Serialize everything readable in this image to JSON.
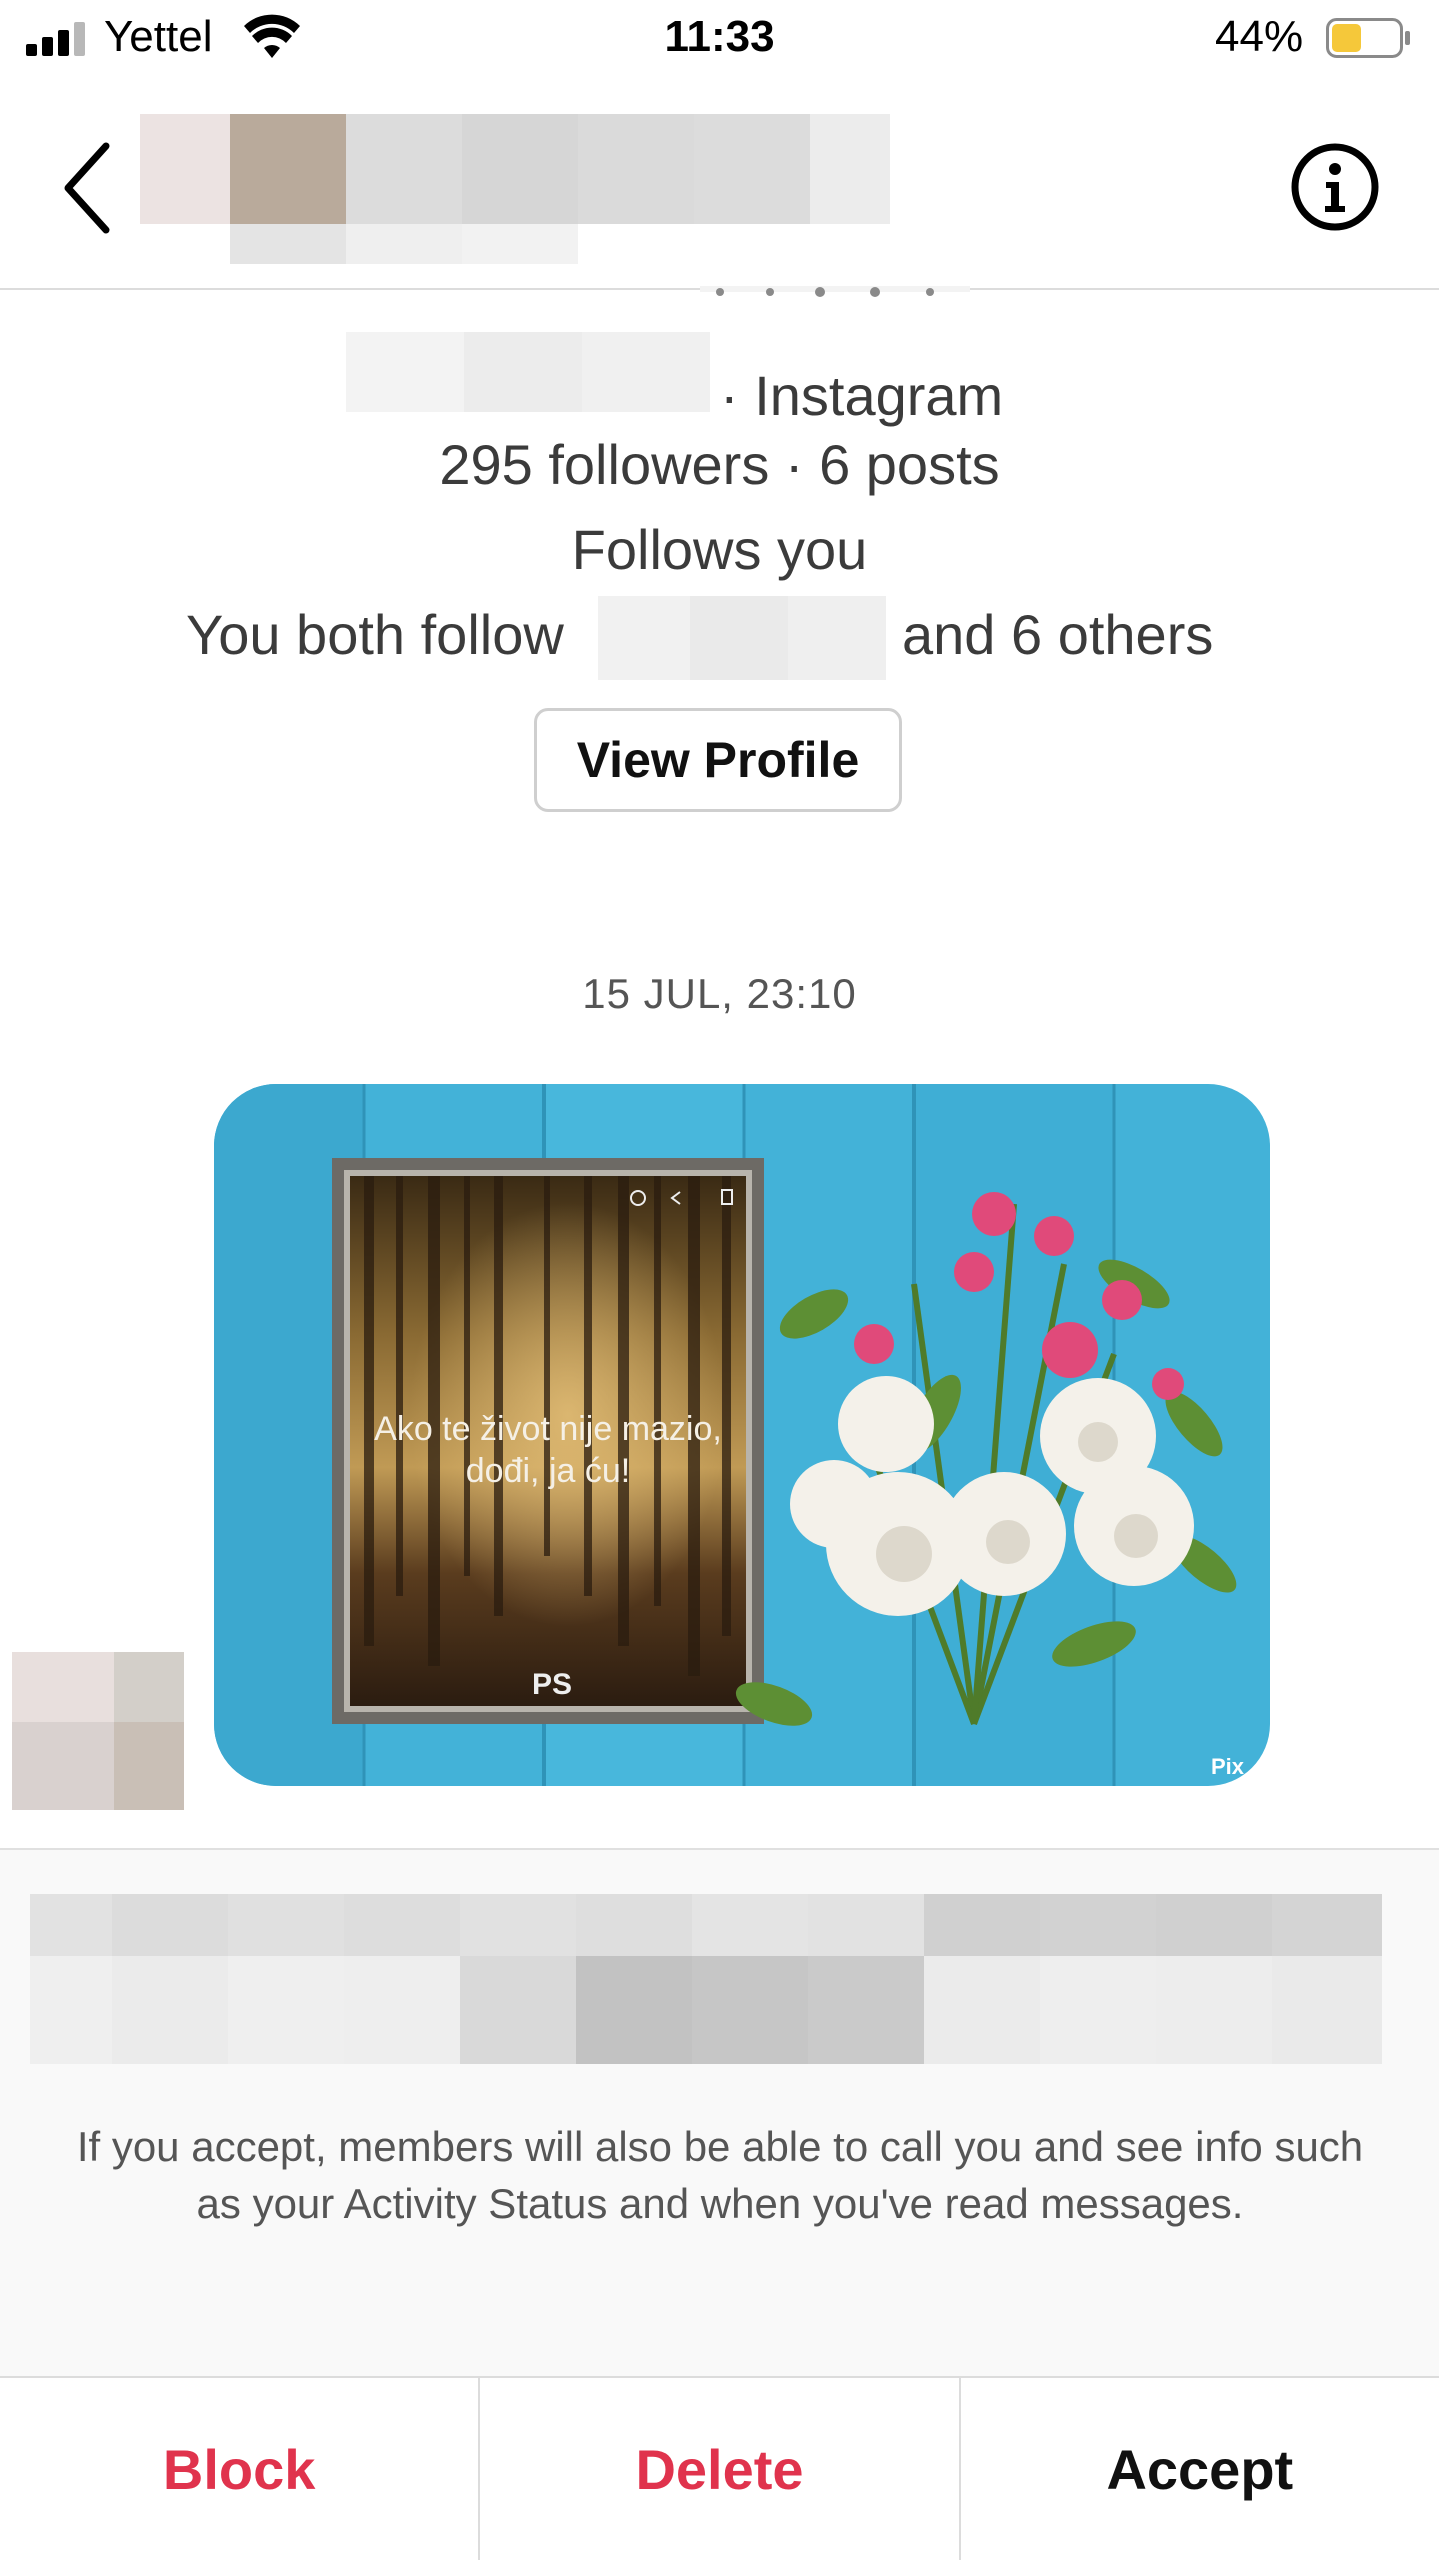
{
  "status_bar": {
    "carrier": "Yettel",
    "time": "11:33",
    "battery_percent": "44%",
    "battery_level": 0.44,
    "icons": [
      "signal-icon",
      "wifi-icon",
      "battery-icon"
    ]
  },
  "header": {
    "back_icon": "chevron-left-icon",
    "info_icon": "info-icon"
  },
  "profile": {
    "sub_suffix": "· Instagram",
    "stats": "295 followers · 6 posts",
    "follows_you": "Follows you",
    "mutual_prefix": "You both follow",
    "mutual_suffix": "and 6 others",
    "view_profile_label": "View Profile"
  },
  "conversation": {
    "timestamp": "15 JUL, 23:10",
    "image_text_line1": "Ako te život nije mazio,",
    "image_text_line2": "dođi, ja ću!",
    "image_logo": "PS",
    "image_watermark": "Pix"
  },
  "request": {
    "note": "If you accept, members will also be able to call you and see info such as your Activity Status and when you've read messages."
  },
  "actions": {
    "block": "Block",
    "delete": "Delete",
    "accept": "Accept"
  },
  "colors": {
    "danger": "#e0334d",
    "battery_fill": "#f5c83a"
  }
}
